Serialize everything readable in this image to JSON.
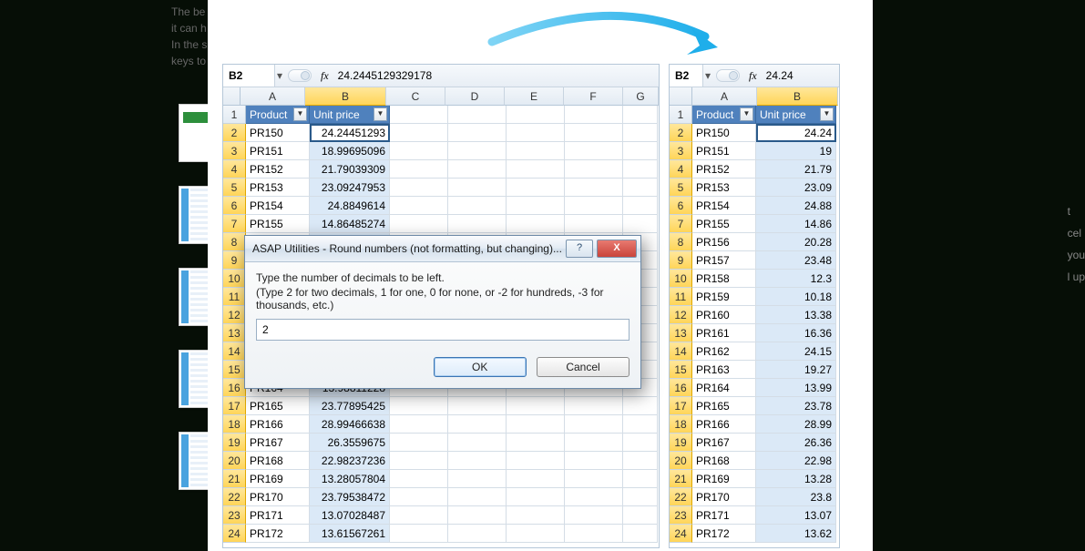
{
  "bg_text_lines": [
    "The be",
    "it can h",
    "In the s",
    "keys to"
  ],
  "behind_lines": [
    "t",
    "cel",
    "you",
    "l up"
  ],
  "left": {
    "cell_ref": "B2",
    "formula": "24.2445129329178",
    "col_labels": [
      "A",
      "B",
      "C",
      "D",
      "E",
      "F",
      "G"
    ],
    "selected_col": "B",
    "headers": [
      "Product",
      "Unit price"
    ],
    "rows": [
      {
        "n": 1
      },
      {
        "n": 2,
        "p": "PR150",
        "v": "24.24451293"
      },
      {
        "n": 3,
        "p": "PR151",
        "v": "18.99695096"
      },
      {
        "n": 4,
        "p": "PR152",
        "v": "21.79039309"
      },
      {
        "n": 5,
        "p": "PR153",
        "v": "23.09247953"
      },
      {
        "n": 6,
        "p": "PR154",
        "v": "24.8849614"
      },
      {
        "n": 7,
        "p": "PR155",
        "v": "14.86485274"
      },
      {
        "n": 8
      },
      {
        "n": 9
      },
      {
        "n": 10
      },
      {
        "n": 11
      },
      {
        "n": 12
      },
      {
        "n": 13
      },
      {
        "n": 14
      },
      {
        "n": 15
      },
      {
        "n": 16,
        "p": "PR164",
        "v": "13.98811228"
      },
      {
        "n": 17,
        "p": "PR165",
        "v": "23.77895425"
      },
      {
        "n": 18,
        "p": "PR166",
        "v": "28.99466638"
      },
      {
        "n": 19,
        "p": "PR167",
        "v": "26.3559675"
      },
      {
        "n": 20,
        "p": "PR168",
        "v": "22.98237236"
      },
      {
        "n": 21,
        "p": "PR169",
        "v": "13.28057804"
      },
      {
        "n": 22,
        "p": "PR170",
        "v": "23.79538472"
      },
      {
        "n": 23,
        "p": "PR171",
        "v": "13.07028487"
      },
      {
        "n": 24,
        "p": "PR172",
        "v": "13.61567261"
      }
    ]
  },
  "right": {
    "cell_ref": "B2",
    "formula": "24.24",
    "col_labels": [
      "A",
      "B"
    ],
    "selected_col": "B",
    "headers": [
      "Product",
      "Unit price"
    ],
    "rows": [
      {
        "n": 1
      },
      {
        "n": 2,
        "p": "PR150",
        "v": "24.24"
      },
      {
        "n": 3,
        "p": "PR151",
        "v": "19"
      },
      {
        "n": 4,
        "p": "PR152",
        "v": "21.79"
      },
      {
        "n": 5,
        "p": "PR153",
        "v": "23.09"
      },
      {
        "n": 6,
        "p": "PR154",
        "v": "24.88"
      },
      {
        "n": 7,
        "p": "PR155",
        "v": "14.86"
      },
      {
        "n": 8,
        "p": "PR156",
        "v": "20.28"
      },
      {
        "n": 9,
        "p": "PR157",
        "v": "23.48"
      },
      {
        "n": 10,
        "p": "PR158",
        "v": "12.3"
      },
      {
        "n": 11,
        "p": "PR159",
        "v": "10.18"
      },
      {
        "n": 12,
        "p": "PR160",
        "v": "13.38"
      },
      {
        "n": 13,
        "p": "PR161",
        "v": "16.36"
      },
      {
        "n": 14,
        "p": "PR162",
        "v": "24.15"
      },
      {
        "n": 15,
        "p": "PR163",
        "v": "19.27"
      },
      {
        "n": 16,
        "p": "PR164",
        "v": "13.99"
      },
      {
        "n": 17,
        "p": "PR165",
        "v": "23.78"
      },
      {
        "n": 18,
        "p": "PR166",
        "v": "28.99"
      },
      {
        "n": 19,
        "p": "PR167",
        "v": "26.36"
      },
      {
        "n": 20,
        "p": "PR168",
        "v": "22.98"
      },
      {
        "n": 21,
        "p": "PR169",
        "v": "13.28"
      },
      {
        "n": 22,
        "p": "PR170",
        "v": "23.8"
      },
      {
        "n": 23,
        "p": "PR171",
        "v": "13.07"
      },
      {
        "n": 24,
        "p": "PR172",
        "v": "13.62"
      }
    ]
  },
  "dialog": {
    "title": "ASAP Utilities - Round numbers (not formatting, but changing)...",
    "line1": "Type the number of decimals to be left.",
    "line2": "(Type 2 for two decimals, 1 for one, 0 for none, or -2 for hundreds, -3 for thousands, etc.)",
    "value": "2",
    "ok": "OK",
    "cancel": "Cancel",
    "help": "?",
    "close": "X"
  }
}
